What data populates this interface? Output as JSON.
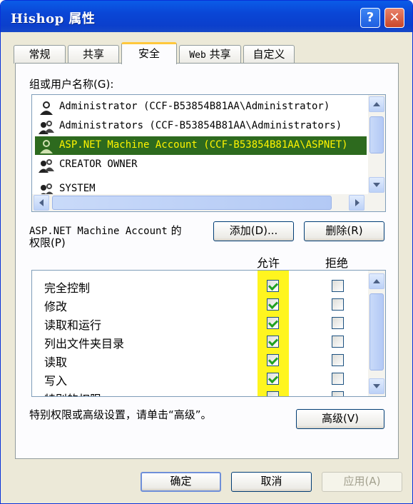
{
  "window": {
    "title": "Hishop 属性",
    "help_label": "?",
    "close_label": "✕"
  },
  "tabs": [
    {
      "label": "常规",
      "active": false
    },
    {
      "label": "共享",
      "active": false
    },
    {
      "label": "安全",
      "active": true
    },
    {
      "label_latin": "Web",
      "label_cn": " 共享",
      "active": false
    },
    {
      "label": "自定义",
      "active": false
    }
  ],
  "groups": {
    "label": "组或用户名称(G):",
    "items": [
      {
        "text": "Administrator (CCF-B53854B81AA\\Administrator)",
        "icon": "single-user-icon",
        "selected": false
      },
      {
        "text": "Administrators (CCF-B53854B81AA\\Administrators)",
        "icon": "user-group-icon",
        "selected": false
      },
      {
        "text": "ASP.NET Machine Account (CCF-B53854B81AA\\ASPNET)",
        "icon": "single-user-icon",
        "selected": true
      },
      {
        "text": "CREATOR OWNER",
        "icon": "user-group-icon",
        "selected": false
      },
      {
        "text": "SYSTEM",
        "icon": "user-group-icon",
        "selected": false
      }
    ]
  },
  "buttons": {
    "add": "添加(D)...",
    "remove": "删除(R)",
    "advanced": "高级(V)",
    "ok": "确定",
    "cancel": "取消",
    "apply": "应用(A)"
  },
  "permissions": {
    "label_line1_latin": "ASP.NET Machine Account",
    "label_line1_cn": " 的",
    "label_line2": "权限(P)",
    "allow_header": "允许",
    "deny_header": "拒绝",
    "rows": [
      {
        "name": "完全控制",
        "allow": true,
        "deny": false
      },
      {
        "name": "修改",
        "allow": true,
        "deny": false
      },
      {
        "name": "读取和运行",
        "allow": true,
        "deny": false
      },
      {
        "name": "列出文件夹目录",
        "allow": true,
        "deny": false
      },
      {
        "name": "读取",
        "allow": true,
        "deny": false
      },
      {
        "name": "写入",
        "allow": true,
        "deny": false
      },
      {
        "name": "特别的权限",
        "allow": false,
        "deny": false
      }
    ]
  },
  "advanced_note": "特别权限或高级设置，请单击“高级”。",
  "colors": {
    "titlebar": "#0a46d6",
    "selection_bg": "#2d6a1e",
    "selection_text": "#fff400",
    "highlight": "#fff51f",
    "check": "#21a121"
  }
}
